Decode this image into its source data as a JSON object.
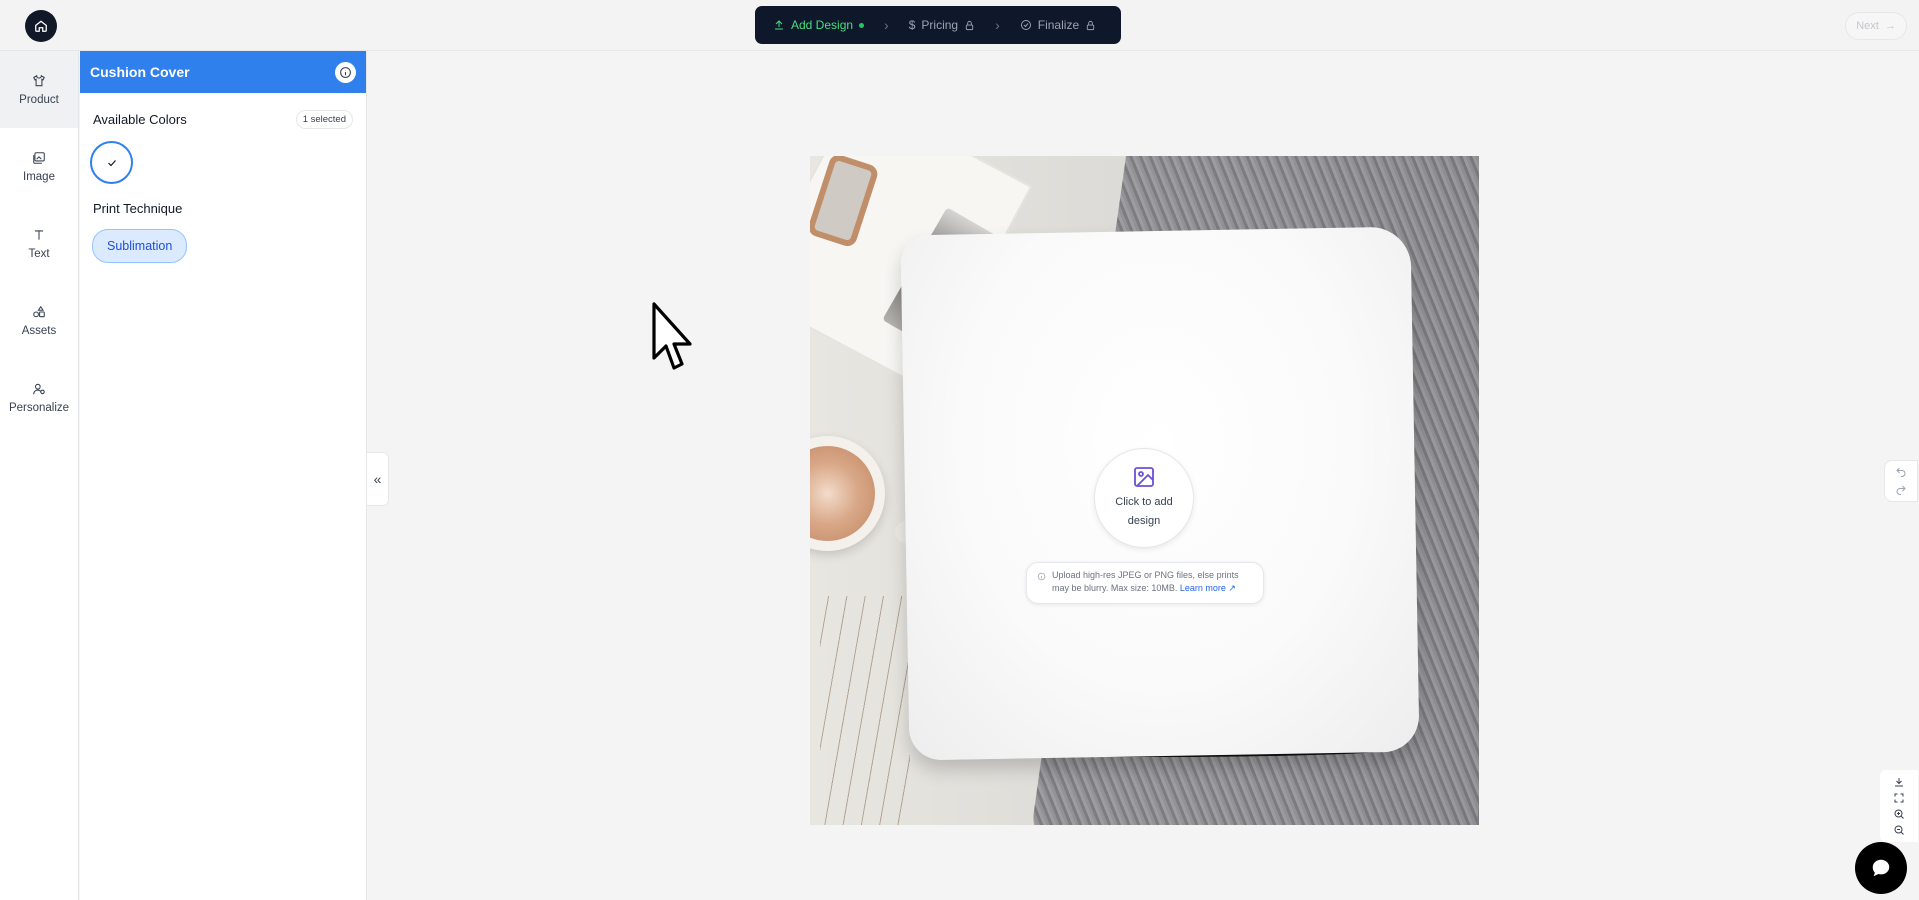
{
  "header": {
    "steps": [
      {
        "label": "Add Design",
        "icon": "upload-icon",
        "state": "active"
      },
      {
        "label": "Pricing",
        "icon": "dollar-icon",
        "state": "locked"
      },
      {
        "label": "Finalize",
        "icon": "check-circle-icon",
        "state": "locked"
      }
    ],
    "next_label": "Next"
  },
  "leftnav": {
    "items": [
      {
        "label": "Product",
        "icon": "shirt-icon",
        "active": true
      },
      {
        "label": "Image",
        "icon": "image-icon",
        "active": false
      },
      {
        "label": "Text",
        "icon": "text-icon",
        "active": false
      },
      {
        "label": "Assets",
        "icon": "shapes-icon",
        "active": false
      },
      {
        "label": "Personalize",
        "icon": "user-icon",
        "active": false
      }
    ]
  },
  "panel": {
    "title": "Cushion Cover",
    "colors_label": "Available Colors",
    "colors_badge": "1 selected",
    "technique_label": "Print Technique",
    "technique_value": "Sublimation"
  },
  "canvas": {
    "add_design_label": "Click to add design",
    "hint_text": "Upload high-res JPEG or PNG files, else prints may be blurry. Max size: 10MB.",
    "hint_link": "Learn more"
  },
  "colors": {
    "accent": "#2f80ed",
    "dark": "#0f172a",
    "active_step": "#4ade80"
  }
}
